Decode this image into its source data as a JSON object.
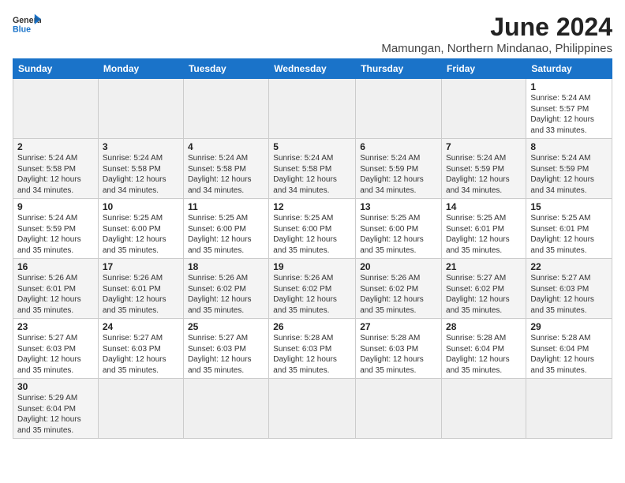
{
  "header": {
    "logo_general": "General",
    "logo_blue": "Blue",
    "month_year": "June 2024",
    "location": "Mamungan, Northern Mindanao, Philippines"
  },
  "days_of_week": [
    "Sunday",
    "Monday",
    "Tuesday",
    "Wednesday",
    "Thursday",
    "Friday",
    "Saturday"
  ],
  "weeks": [
    [
      {
        "day": "",
        "info": ""
      },
      {
        "day": "",
        "info": ""
      },
      {
        "day": "",
        "info": ""
      },
      {
        "day": "",
        "info": ""
      },
      {
        "day": "",
        "info": ""
      },
      {
        "day": "",
        "info": ""
      },
      {
        "day": "1",
        "info": "Sunrise: 5:24 AM\nSunset: 5:57 PM\nDaylight: 12 hours\nand 33 minutes."
      }
    ],
    [
      {
        "day": "2",
        "info": "Sunrise: 5:24 AM\nSunset: 5:58 PM\nDaylight: 12 hours\nand 34 minutes."
      },
      {
        "day": "3",
        "info": "Sunrise: 5:24 AM\nSunset: 5:58 PM\nDaylight: 12 hours\nand 34 minutes."
      },
      {
        "day": "4",
        "info": "Sunrise: 5:24 AM\nSunset: 5:58 PM\nDaylight: 12 hours\nand 34 minutes."
      },
      {
        "day": "5",
        "info": "Sunrise: 5:24 AM\nSunset: 5:58 PM\nDaylight: 12 hours\nand 34 minutes."
      },
      {
        "day": "6",
        "info": "Sunrise: 5:24 AM\nSunset: 5:59 PM\nDaylight: 12 hours\nand 34 minutes."
      },
      {
        "day": "7",
        "info": "Sunrise: 5:24 AM\nSunset: 5:59 PM\nDaylight: 12 hours\nand 34 minutes."
      },
      {
        "day": "8",
        "info": "Sunrise: 5:24 AM\nSunset: 5:59 PM\nDaylight: 12 hours\nand 34 minutes."
      }
    ],
    [
      {
        "day": "9",
        "info": "Sunrise: 5:24 AM\nSunset: 5:59 PM\nDaylight: 12 hours\nand 35 minutes."
      },
      {
        "day": "10",
        "info": "Sunrise: 5:25 AM\nSunset: 6:00 PM\nDaylight: 12 hours\nand 35 minutes."
      },
      {
        "day": "11",
        "info": "Sunrise: 5:25 AM\nSunset: 6:00 PM\nDaylight: 12 hours\nand 35 minutes."
      },
      {
        "day": "12",
        "info": "Sunrise: 5:25 AM\nSunset: 6:00 PM\nDaylight: 12 hours\nand 35 minutes."
      },
      {
        "day": "13",
        "info": "Sunrise: 5:25 AM\nSunset: 6:00 PM\nDaylight: 12 hours\nand 35 minutes."
      },
      {
        "day": "14",
        "info": "Sunrise: 5:25 AM\nSunset: 6:01 PM\nDaylight: 12 hours\nand 35 minutes."
      },
      {
        "day": "15",
        "info": "Sunrise: 5:25 AM\nSunset: 6:01 PM\nDaylight: 12 hours\nand 35 minutes."
      }
    ],
    [
      {
        "day": "16",
        "info": "Sunrise: 5:26 AM\nSunset: 6:01 PM\nDaylight: 12 hours\nand 35 minutes."
      },
      {
        "day": "17",
        "info": "Sunrise: 5:26 AM\nSunset: 6:01 PM\nDaylight: 12 hours\nand 35 minutes."
      },
      {
        "day": "18",
        "info": "Sunrise: 5:26 AM\nSunset: 6:02 PM\nDaylight: 12 hours\nand 35 minutes."
      },
      {
        "day": "19",
        "info": "Sunrise: 5:26 AM\nSunset: 6:02 PM\nDaylight: 12 hours\nand 35 minutes."
      },
      {
        "day": "20",
        "info": "Sunrise: 5:26 AM\nSunset: 6:02 PM\nDaylight: 12 hours\nand 35 minutes."
      },
      {
        "day": "21",
        "info": "Sunrise: 5:27 AM\nSunset: 6:02 PM\nDaylight: 12 hours\nand 35 minutes."
      },
      {
        "day": "22",
        "info": "Sunrise: 5:27 AM\nSunset: 6:03 PM\nDaylight: 12 hours\nand 35 minutes."
      }
    ],
    [
      {
        "day": "23",
        "info": "Sunrise: 5:27 AM\nSunset: 6:03 PM\nDaylight: 12 hours\nand 35 minutes."
      },
      {
        "day": "24",
        "info": "Sunrise: 5:27 AM\nSunset: 6:03 PM\nDaylight: 12 hours\nand 35 minutes."
      },
      {
        "day": "25",
        "info": "Sunrise: 5:27 AM\nSunset: 6:03 PM\nDaylight: 12 hours\nand 35 minutes."
      },
      {
        "day": "26",
        "info": "Sunrise: 5:28 AM\nSunset: 6:03 PM\nDaylight: 12 hours\nand 35 minutes."
      },
      {
        "day": "27",
        "info": "Sunrise: 5:28 AM\nSunset: 6:03 PM\nDaylight: 12 hours\nand 35 minutes."
      },
      {
        "day": "28",
        "info": "Sunrise: 5:28 AM\nSunset: 6:04 PM\nDaylight: 12 hours\nand 35 minutes."
      },
      {
        "day": "29",
        "info": "Sunrise: 5:28 AM\nSunset: 6:04 PM\nDaylight: 12 hours\nand 35 minutes."
      }
    ],
    [
      {
        "day": "30",
        "info": "Sunrise: 5:29 AM\nSunset: 6:04 PM\nDaylight: 12 hours\nand 35 minutes."
      },
      {
        "day": "",
        "info": ""
      },
      {
        "day": "",
        "info": ""
      },
      {
        "day": "",
        "info": ""
      },
      {
        "day": "",
        "info": ""
      },
      {
        "day": "",
        "info": ""
      },
      {
        "day": "",
        "info": ""
      }
    ]
  ]
}
